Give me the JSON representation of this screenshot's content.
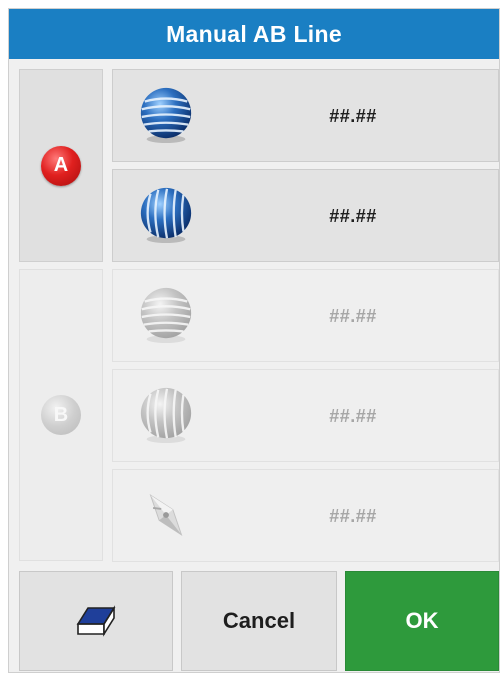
{
  "dialog": {
    "title": "Manual AB Line"
  },
  "point_a": {
    "badge": "A",
    "latitude": {
      "icon": "latitude-globe-icon",
      "value": "##.##"
    },
    "longitude": {
      "icon": "longitude-globe-icon",
      "value": "##.##"
    }
  },
  "point_b": {
    "badge": "B",
    "latitude": {
      "icon": "latitude-globe-icon",
      "value": "##.##"
    },
    "longitude": {
      "icon": "longitude-globe-icon",
      "value": "##.##"
    },
    "heading": {
      "icon": "heading-compass-icon",
      "value": "##.##"
    }
  },
  "footer": {
    "clear_icon": "eraser-icon",
    "cancel_label": "Cancel",
    "ok_label": "OK"
  },
  "colors": {
    "title_bar": "#1a7fc3",
    "ok_button": "#2e9a3c",
    "point_a_badge": "#e0201f"
  }
}
